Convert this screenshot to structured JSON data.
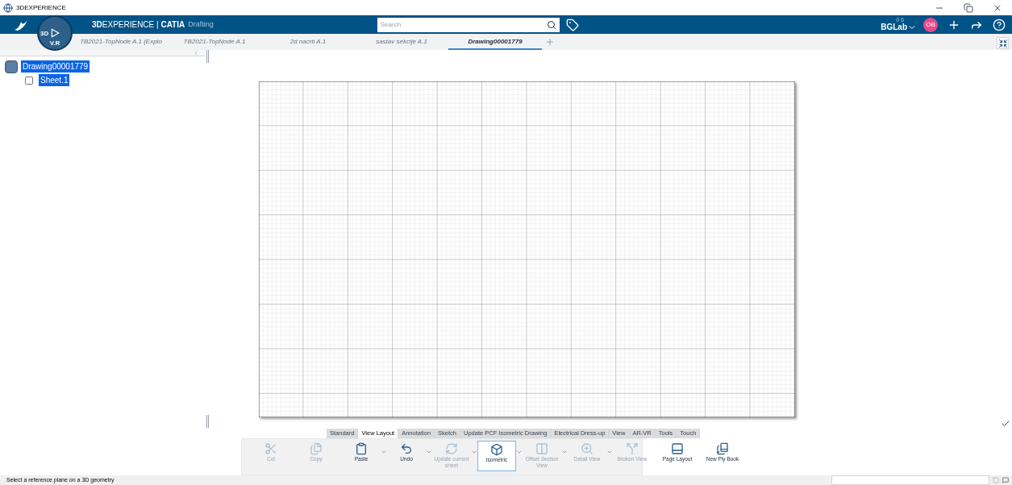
{
  "window": {
    "title": "3DEXPERIENCE"
  },
  "header": {
    "brand": "**3D**EXPERIENCE | **CATIA**",
    "app": "Drafting",
    "compass_labels": [
      "3D",
      "V.R"
    ],
    "search": {
      "placeholder": "Search"
    },
    "tenant_code": "0 6",
    "tenant": "BGLab",
    "avatar": "OB"
  },
  "doc_tabs": [
    {
      "label": "TB2021-TopNode A.1 (Explo",
      "selected": false
    },
    {
      "label": "TB2021-TopNode A.1",
      "selected": false
    },
    {
      "label": "2d nacrti A.1",
      "selected": false
    },
    {
      "label": "sastav sekcije A.1",
      "selected": false
    },
    {
      "label": "Drawing00001779",
      "selected": true
    }
  ],
  "tree": [
    {
      "label": "Drawing00001779",
      "selected": true,
      "children": [
        {
          "label": "Sheet.1",
          "selected": true
        }
      ]
    }
  ],
  "ribbon_tabs": [
    {
      "label": "Standard",
      "selected": false
    },
    {
      "label": "View Layout",
      "selected": true
    },
    {
      "label": "Annotation",
      "selected": false
    },
    {
      "label": "Sketch",
      "selected": false
    },
    {
      "label": "Update PCF Isometric Drawing",
      "selected": false
    },
    {
      "label": "Electrical Dress-up",
      "selected": false
    },
    {
      "label": "View",
      "selected": false
    },
    {
      "label": "AR-VR",
      "selected": false
    },
    {
      "label": "Tools",
      "selected": false
    },
    {
      "label": "Touch",
      "selected": false
    }
  ],
  "tools": [
    {
      "kind": "cut",
      "label": "Cut",
      "disabled": true,
      "dropdown": false,
      "selected": false
    },
    {
      "kind": "copy",
      "label": "Copy",
      "disabled": true,
      "dropdown": false,
      "selected": false
    },
    {
      "kind": "paste",
      "label": "Paste",
      "disabled": false,
      "dropdown": true,
      "selected": false
    },
    {
      "kind": "undo",
      "label": "Undo",
      "disabled": false,
      "dropdown": true,
      "selected": false
    },
    {
      "kind": "update",
      "label": "Update current sheet",
      "disabled": true,
      "dropdown": true,
      "selected": false
    },
    {
      "kind": "isometric",
      "label": "Isometric",
      "disabled": false,
      "dropdown": true,
      "selected": true
    },
    {
      "kind": "section",
      "label": "Offset Section View",
      "disabled": true,
      "dropdown": true,
      "selected": false
    },
    {
      "kind": "detail",
      "label": "Detail View",
      "disabled": true,
      "dropdown": true,
      "selected": false
    },
    {
      "kind": "broken",
      "label": "Broken View",
      "disabled": true,
      "dropdown": false,
      "selected": false
    },
    {
      "kind": "page",
      "label": "Page Layout",
      "disabled": false,
      "dropdown": false,
      "selected": false
    },
    {
      "kind": "plybook",
      "label": "New Ply Book",
      "disabled": false,
      "dropdown": false,
      "selected": false
    }
  ],
  "status_bar": {
    "message": "Select a reference plane on a 3D geometry"
  }
}
